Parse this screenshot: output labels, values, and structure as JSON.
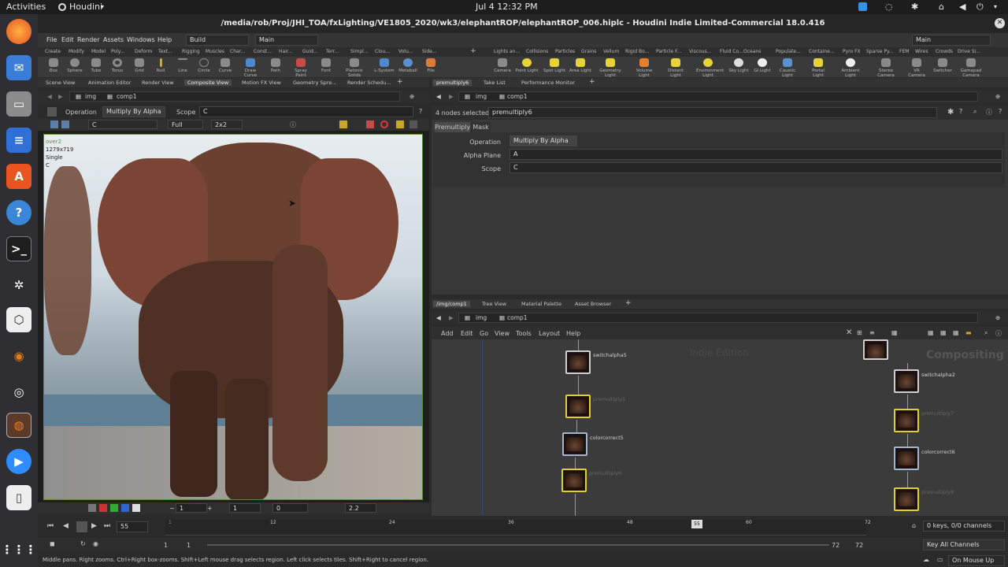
{
  "system": {
    "activities": "Activities",
    "app": "Houdini",
    "datetime": "Jul 4  12:32 PM"
  },
  "window": {
    "title": "/media/rob/Proj/JHI_TOA/fxLighting/VE1805_2020/wk3/elephantROP/elephantROP_006.hiplc - Houdini Indie Limited-Commercial 18.0.416"
  },
  "menu": {
    "items": [
      "File",
      "Edit",
      "Render",
      "Assets",
      "Windows",
      "Help"
    ],
    "desktop": "Build",
    "main": "Main",
    "right_main": "Main"
  },
  "shelf_tabs_left": [
    "Create",
    "Modify",
    "Model",
    "Poly...",
    "Deform",
    "Text...",
    "Rigging",
    "Muscles",
    "Char...",
    "Const...",
    "Hair...",
    "Guid...",
    "Terr...",
    "Simpl...",
    "Clou...",
    "Volu...",
    "Side..."
  ],
  "shelf_tabs_right": [
    "Lights an...",
    "Collisions",
    "Particles",
    "Grains",
    "Vellum",
    "Rigid Bo...",
    "Particle F...",
    "Viscous...",
    "Fluid Co...",
    "Oceans",
    "Populate...",
    "Containe...",
    "Pyro FX",
    "Sparse Py...",
    "FEM",
    "Wires",
    "Crowds",
    "Drive Si..."
  ],
  "tools_left": [
    "Box",
    "Sphere",
    "Tube",
    "Torus",
    "Grid",
    "Null",
    "Line",
    "Circle",
    "Curve",
    "Draw Curve",
    "Path",
    "Spray Paint",
    "Font",
    "Platonic Solids",
    "L-System",
    "Metaball",
    "File"
  ],
  "tools_right": [
    "Camera",
    "Point Light",
    "Spot Light",
    "Area Light",
    "Geometry Light",
    "Volume Light",
    "Distant Light",
    "Environment Light",
    "Sky Light",
    "GI Light",
    "Caustic Light",
    "Portal Light",
    "Ambient Light",
    "Stereo Camera",
    "VR Camera",
    "Switcher",
    "Gamepad Camera"
  ],
  "left_tabs": [
    "Scene View",
    "Animation Editor",
    "Render View",
    "Composite View",
    "Motion FX View",
    "Geometry Spre...",
    "Render Schedu..."
  ],
  "left_path": {
    "net": "img",
    "node": "comp1"
  },
  "viewer": {
    "operation_label": "Operation",
    "operation_value": "Multiply By Alpha",
    "scope_label": "Scope",
    "scope_value": "C",
    "plane": "C",
    "res": "Full",
    "zoom": "2x2"
  },
  "image_info": [
    "over2",
    "1279x719",
    "Single",
    "C"
  ],
  "viewer_bottom": {
    "frame": "1",
    "val1": "1",
    "val2": "0",
    "gamma": "2.2"
  },
  "right_tabs": [
    "premultiply6",
    "Take List",
    "Performance Monitor"
  ],
  "right_path": {
    "net": "img",
    "node": "comp1"
  },
  "params": {
    "selected": "4 nodes selected:",
    "node_name": "premultiply6",
    "tabs": [
      "Premultiply",
      "Mask"
    ],
    "rows": [
      {
        "label": "Operation",
        "value": "Multiply By Alpha"
      },
      {
        "label": "Alpha Plane",
        "value": "A"
      },
      {
        "label": "Scope",
        "value": "C"
      }
    ]
  },
  "net_tabs": [
    "/img/comp1",
    "Tree View",
    "Material Palette",
    "Asset Browser"
  ],
  "net_path": {
    "net": "img",
    "node": "comp1"
  },
  "net_menu": [
    "Add",
    "Edit",
    "Go",
    "View",
    "Tools",
    "Layout",
    "Help"
  ],
  "net_watermarks": {
    "edition": "Indie Edition",
    "context": "Compositing"
  },
  "nodes": [
    "switchalpha5",
    "premultiply1",
    "colorcorrect5",
    "premultiply6",
    "switchalpha2",
    "premultiply7",
    "colorcorrect6",
    "premultiply8"
  ],
  "timeline": {
    "frame": "55",
    "ticks": [
      "1",
      "12",
      "24",
      "36",
      "48",
      "55",
      "60",
      "72"
    ],
    "start": "1",
    "start2": "1",
    "end": "72",
    "end2": "72",
    "keys": "0 keys, 0/0 channels",
    "key_all": "Key All Channels"
  },
  "status": {
    "hint": "Middle pans. Right zooms. Ctrl+Right box-zooms.  Shift+Left mouse drag selects region. Left click selects tiles. Shift+Right to cancel region.",
    "update": "On Mouse Up"
  }
}
